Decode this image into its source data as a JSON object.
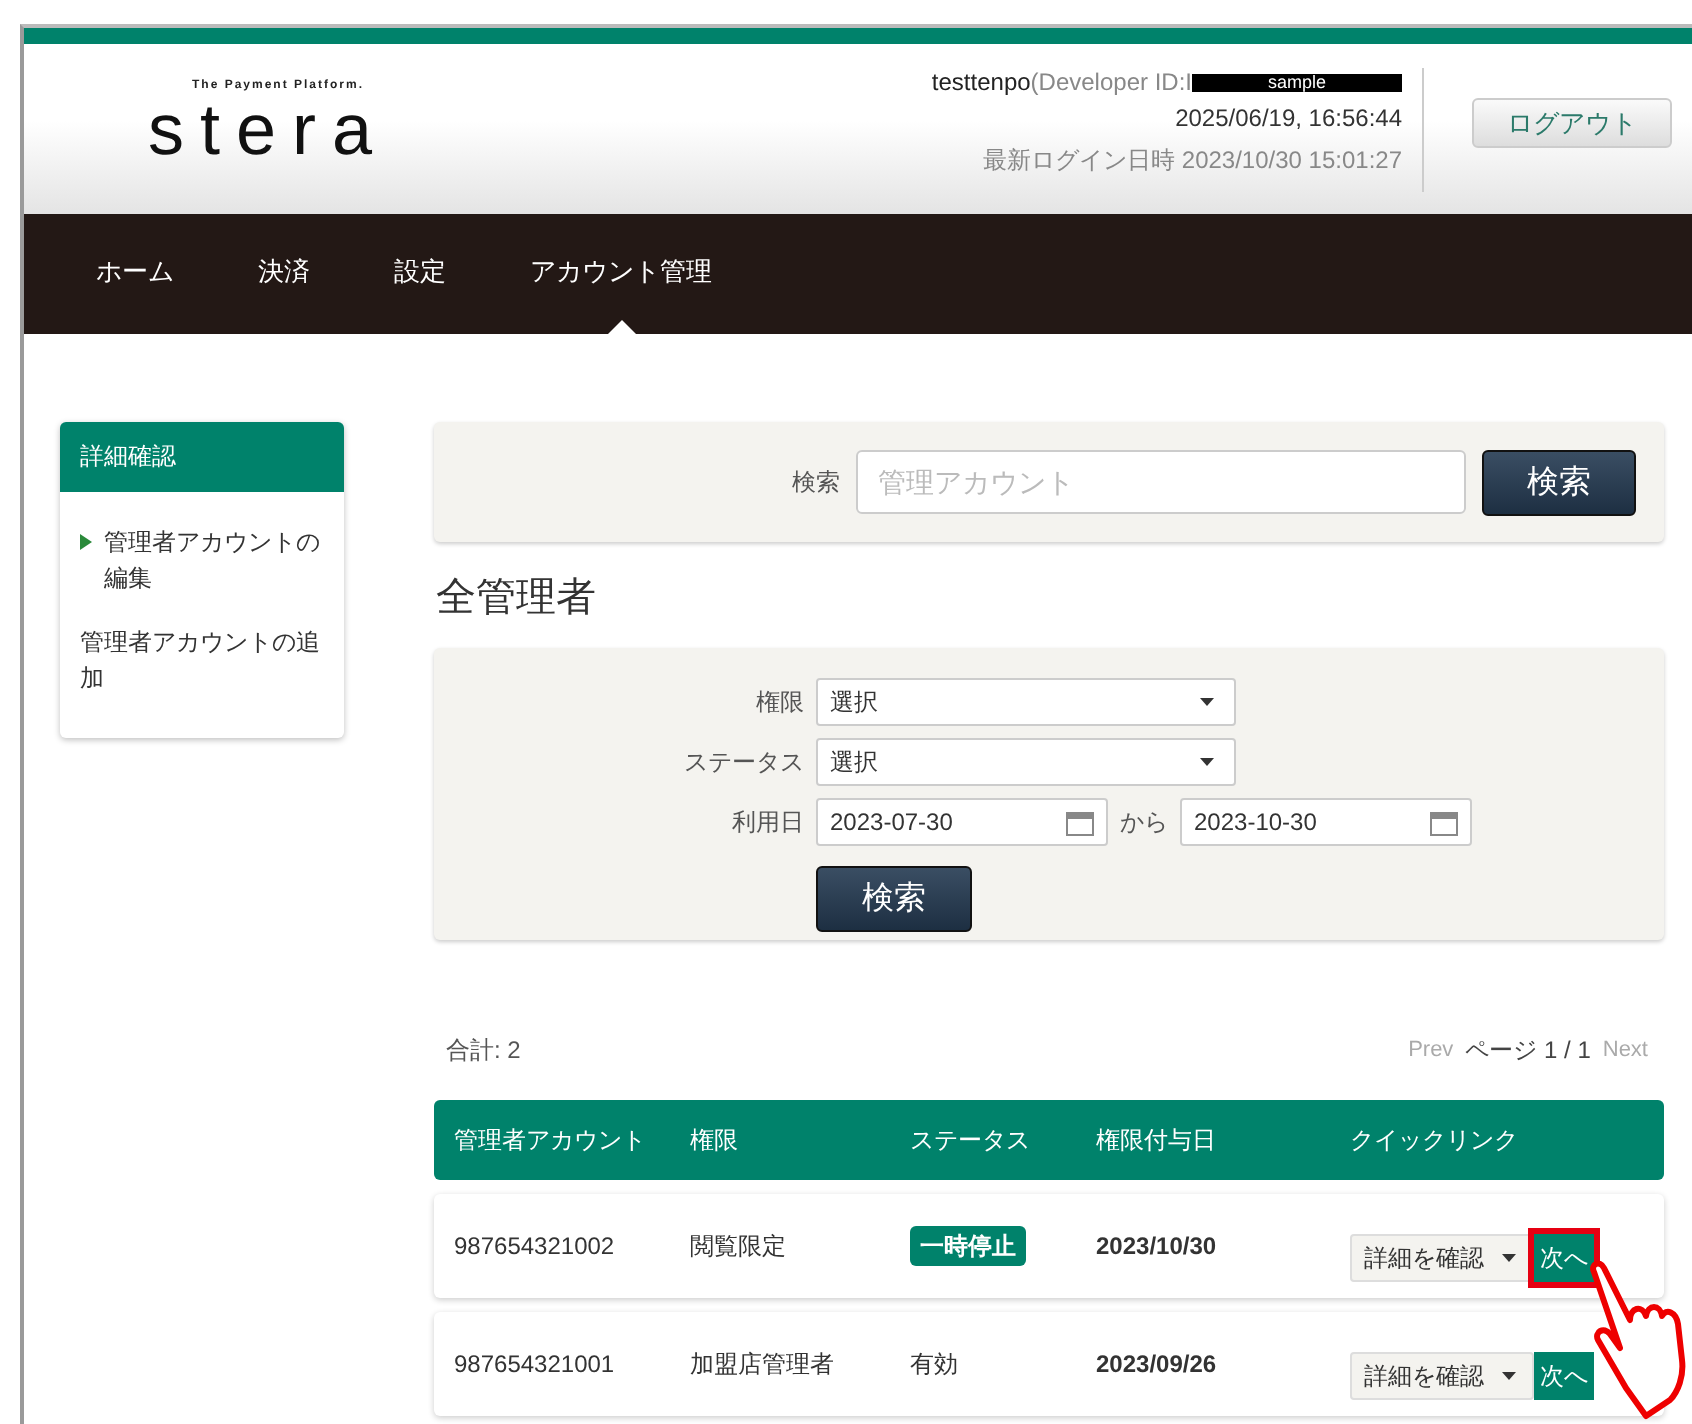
{
  "header": {
    "logo_tagline": "The Payment Platform.",
    "logo": "stera",
    "user": "testtenpo",
    "developer_id": "(Developer ID:I",
    "redacted": "sample",
    "datetime": "2025/06/19, 16:56:44",
    "last_login": "最新ログイン日時 2023/10/30 15:01:27",
    "logout": "ログアウト"
  },
  "nav": [
    {
      "label": "ホーム",
      "selected": false
    },
    {
      "label": "決済",
      "selected": false
    },
    {
      "label": "設定",
      "selected": false
    },
    {
      "label": "アカウント管理",
      "selected": true
    }
  ],
  "sidebar": {
    "title": "詳細確認",
    "items": [
      {
        "label": "管理者アカウントの編集",
        "selected": true
      },
      {
        "label": "管理者アカウントの追加",
        "selected": false
      }
    ]
  },
  "search": {
    "label": "検索",
    "placeholder": "管理アカウント",
    "button": "検索"
  },
  "heading": "全管理者",
  "filters": {
    "role_label": "権限",
    "role_value": "選択",
    "status_label": "ステータス",
    "status_value": "選択",
    "date_label": "利用日",
    "date_from": "2023-07-30",
    "date_sep": "から",
    "date_to": "2023-10-30",
    "button": "検索"
  },
  "total": "合計: 2",
  "pager": {
    "prev": "Prev",
    "page": "ページ 1 / 1",
    "next": "Next"
  },
  "table": {
    "columns": [
      "管理者アカウント",
      "権限",
      "ステータス",
      "権限付与日",
      "クイックリンク"
    ],
    "rows": [
      {
        "account": "987654321002",
        "role": "閲覧限定",
        "status": "一時停止",
        "kind": "badge",
        "date": "2023/10/30",
        "action": "詳細を確認",
        "button": "次へ",
        "highlighted": true
      },
      {
        "account": "987654321001",
        "role": "加盟店管理者",
        "status": "有効",
        "kind": "plain",
        "date": "2023/09/26",
        "action": "詳細を確認",
        "button": "次へ",
        "highlighted": false
      }
    ]
  }
}
